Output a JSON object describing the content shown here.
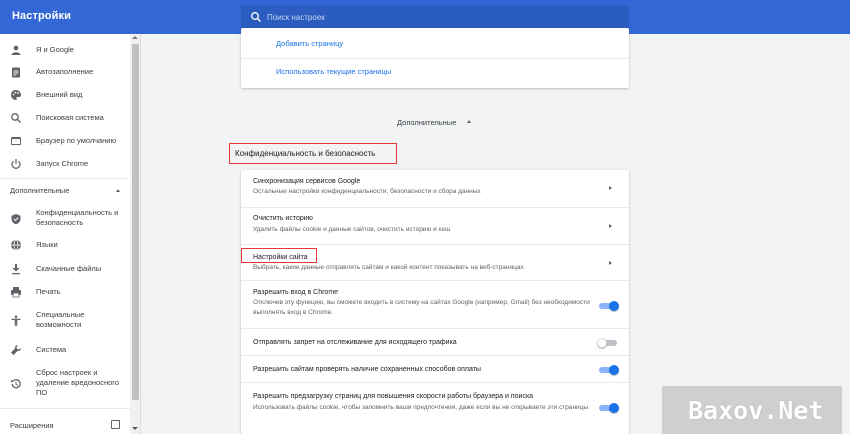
{
  "app": {
    "title": "Настройки",
    "accent_color": "#3367d6",
    "link_color": "#1a73e8",
    "highlight_color": "#e53935"
  },
  "search": {
    "placeholder": "Поиск настроек",
    "icon": "search-icon"
  },
  "sidebar": {
    "items": [
      {
        "label": "Я и Google",
        "icon": "person-icon"
      },
      {
        "label": "Автозаполнение",
        "icon": "clipboard-icon"
      },
      {
        "label": "Внешний вид",
        "icon": "palette-icon"
      },
      {
        "label": "Поисковая система",
        "icon": "search-icon"
      },
      {
        "label": "Браузер по умолчанию",
        "icon": "browser-window-icon"
      },
      {
        "label": "Запуск Chrome",
        "icon": "power-icon"
      }
    ],
    "advanced_label": "Дополнительные",
    "advanced_items": [
      {
        "label": "Конфиденциальность и безопасность",
        "icon": "shield-icon"
      },
      {
        "label": "Языки",
        "icon": "globe-icon"
      },
      {
        "label": "Скачанные файлы",
        "icon": "download-icon"
      },
      {
        "label": "Печать",
        "icon": "printer-icon"
      },
      {
        "label": "Специальные возможности",
        "icon": "accessibility-icon"
      },
      {
        "label": "Система",
        "icon": "wrench-icon"
      },
      {
        "label": "Сброс настроек и удаление вредоносного ПО",
        "icon": "restore-icon"
      }
    ],
    "extensions_label": "Расширения",
    "extensions_icon": "open-in-new-icon"
  },
  "startup_card": {
    "add_page": "Добавить страницу",
    "use_current": "Использовать текущие страницы"
  },
  "advanced_toggle": {
    "label": "Дополнительные"
  },
  "privacy": {
    "heading": "Конфиденциальность и безопасность",
    "rows": [
      {
        "title": "Синхронизация сервисов Google",
        "sub": "Остальные настройки конфиденциальности, безопасности и сбора данных",
        "control": "arrow"
      },
      {
        "title": "Очистить историю",
        "sub": "Удалить файлы cookie и данные сайтов, очистить историю и кеш",
        "control": "arrow"
      },
      {
        "title": "Настройки сайта",
        "sub": "Выбрать, какие данные отправлять сайтам и какой контент показывать на веб-страницах",
        "control": "arrow"
      },
      {
        "title": "Разрешить вход в Chrome",
        "sub": "Отключив эту функцию, вы сможете входить в систему на сайтах Google (например, Gmail) без необходимости выполнять вход в Chrome.",
        "control": "toggle",
        "on": true
      },
      {
        "title": "Отправлять запрет на отслеживание для исходящего трафика",
        "sub": "",
        "control": "toggle",
        "on": false
      },
      {
        "title": "Разрешить сайтам проверять наличие сохраненных способов оплаты",
        "sub": "",
        "control": "toggle",
        "on": true
      },
      {
        "title": "Разрешить предзагрузку страниц для повышения скорости работы браузера и поиска",
        "sub": "Использовать файлы cookie, чтобы запомнить ваши предпочтения, даже если вы не открываете эти страницы",
        "control": "toggle",
        "on": true
      }
    ]
  },
  "watermark": {
    "text": "Baxov.Net"
  }
}
